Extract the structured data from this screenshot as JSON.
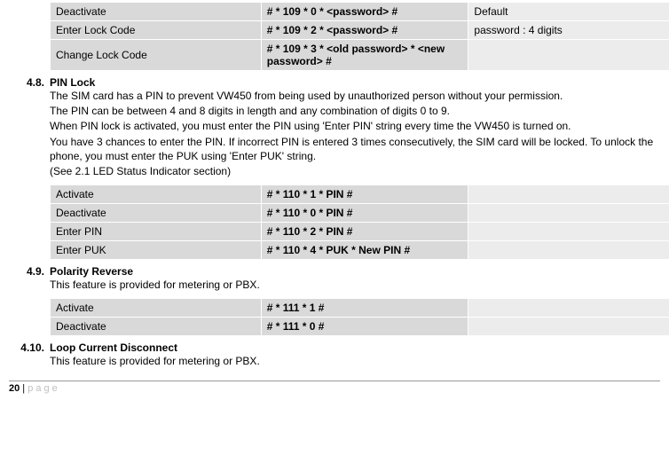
{
  "top_table": {
    "rows": [
      {
        "label": "Deactivate",
        "cmd": "# * 109 * 0 * <password> #",
        "note": "Default"
      },
      {
        "label": "Enter Lock Code",
        "cmd": "# * 109 * 2 * <password> #",
        "note": "password : 4 digits"
      },
      {
        "label": "Change Lock Code",
        "cmd": "# * 109 * 3 * <old password> * <new password> #",
        "note": ""
      }
    ]
  },
  "s48": {
    "num": "4.8.",
    "title": "PIN Lock",
    "p1": "The SIM card has a PIN to prevent VW450 from being used by unauthorized person without your permission.",
    "p2": "The PIN can be between 4 and 8 digits in length and any combination of digits 0 to 9.",
    "p3": "When PIN lock is activated, you must enter the PIN using 'Enter PIN' string every time the VW450 is turned on.",
    "p4": "You have 3 chances to enter the PIN. If incorrect PIN is entered 3 times consecutively, the SIM card will be locked. To unlock the phone, you must enter the PUK using 'Enter PUK' string.",
    "p5": "(See 2.1 LED Status Indicator section)",
    "rows": [
      {
        "label": "Activate",
        "cmd": "# * 110 * 1 * PIN #",
        "note": ""
      },
      {
        "label": "Deactivate",
        "cmd": "# * 110 * 0 * PIN #",
        "note": ""
      },
      {
        "label": "Enter PIN",
        "cmd": "# * 110 * 2 * PIN #",
        "note": ""
      },
      {
        "label": "Enter PUK",
        "cmd": "# * 110 * 4 * PUK * New PIN #",
        "note": ""
      }
    ]
  },
  "s49": {
    "num": "4.9.",
    "title": "Polarity Reverse",
    "p1": "This feature is provided for metering or PBX.",
    "rows": [
      {
        "label": "Activate",
        "cmd": "# * 111 * 1 #",
        "note": ""
      },
      {
        "label": "Deactivate",
        "cmd": "# * 111 * 0 #",
        "note": ""
      }
    ]
  },
  "s410": {
    "num": "4.10.",
    "title": "Loop Current Disconnect",
    "p1": "This feature is provided for metering or PBX."
  },
  "footer": {
    "pagenum": "20",
    "sep": " | ",
    "label": "page"
  }
}
